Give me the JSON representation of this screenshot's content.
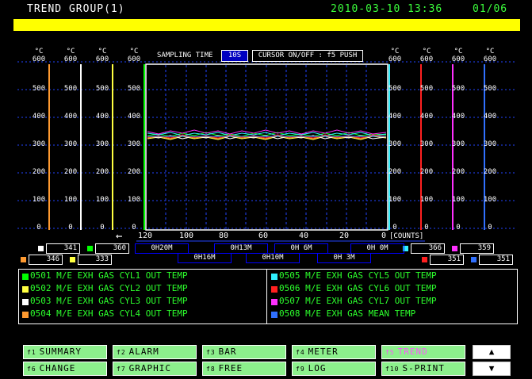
{
  "header": {
    "title": "TREND GROUP(1)",
    "datetime": "2010-03-10 13:36",
    "page": "01/06"
  },
  "colors": {
    "status_bar": "#ffff00",
    "cyl1": "#00ff00",
    "cyl2": "#ffff40",
    "cyl3": "#ffffff",
    "cyl4": "#ff9a30",
    "cyl5": "#30f0ff",
    "cyl6": "#ff2020",
    "cyl7": "#ff30ff",
    "mean": "#3070ff",
    "function_key": "#8cf08c",
    "active_key_text": "#ff55ff"
  },
  "controls": {
    "sampling_label": "SAMPLING TIME",
    "sampling_value": "10S",
    "cursor_label": "CURSOR ON/OFF : f5 PUSH"
  },
  "axes": {
    "unit": "°C",
    "scale_max": "600",
    "ticks": [
      "600",
      "500",
      "400",
      "300",
      "200",
      "100",
      "0"
    ],
    "time_ticks": [
      "120",
      "100",
      "80",
      "60",
      "40",
      "20",
      "0"
    ],
    "time_unit": "[COUNTS]",
    "arrow": "←"
  },
  "scale_values": {
    "left_row1": [
      "341",
      "360"
    ],
    "left_row2": [
      "346",
      "333"
    ],
    "right_row1": [
      "366",
      "359"
    ],
    "right_row2": [
      "351",
      "351"
    ]
  },
  "time_markers": {
    "row1": [
      "0H20M",
      "0H13M",
      "0H 6M",
      "0H 0M"
    ],
    "row2": [
      "0H16M",
      "0H10M",
      "0H 3M"
    ]
  },
  "legend": {
    "left": [
      "0501 M/E EXH GAS CYL1 OUT TEMP",
      "0502 M/E EXH GAS CYL2 OUT TEMP",
      "0503 M/E EXH GAS CYL3 OUT TEMP",
      "0504 M/E EXH GAS CYL4 OUT TEMP"
    ],
    "right": [
      "0505 M/E EXH GAS CYL5 OUT TEMP",
      "0506 M/E EXH GAS CYL6 OUT TEMP",
      "0507 M/E EXH GAS CYL7 OUT TEMP",
      "0508 M/E EXH GAS MEAN TEMP"
    ]
  },
  "function_keys": {
    "row1": [
      {
        "fn": "f1",
        "label": "SUMMARY"
      },
      {
        "fn": "f2",
        "label": "ALARM"
      },
      {
        "fn": "f3",
        "label": "BAR"
      },
      {
        "fn": "f4",
        "label": "METER"
      },
      {
        "fn": "f5",
        "label": "TREND"
      }
    ],
    "row2": [
      {
        "fn": "f6",
        "label": "CHANGE"
      },
      {
        "fn": "f7",
        "label": "GRAPHIC"
      },
      {
        "fn": "f8",
        "label": "FREE"
      },
      {
        "fn": "f9",
        "label": "LOG"
      },
      {
        "fn": "f10",
        "label": "S-PRINT"
      }
    ],
    "up": "▲",
    "down": "▼"
  }
}
